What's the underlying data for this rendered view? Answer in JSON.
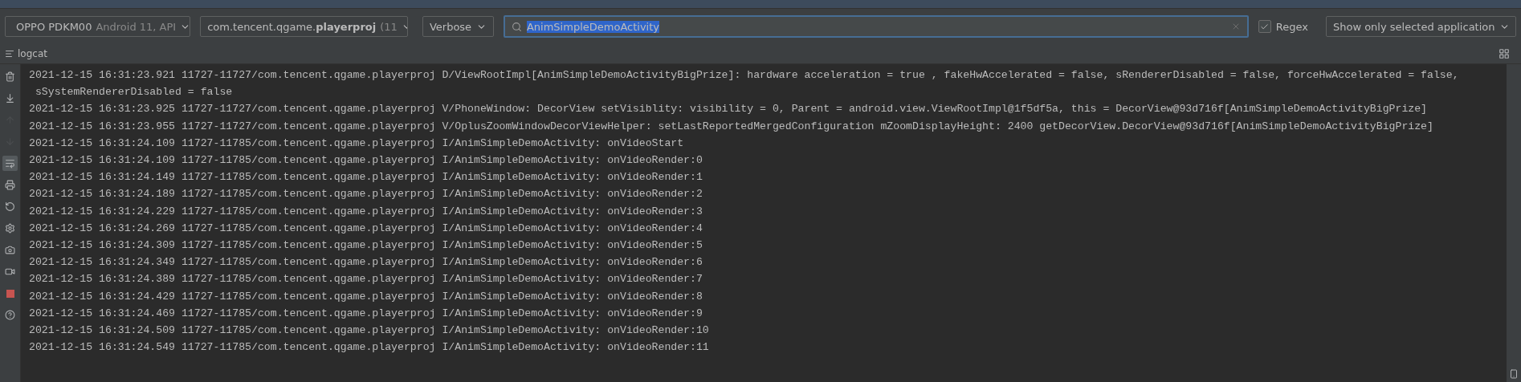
{
  "toolbar": {
    "device": {
      "name": "OPPO PDKM00",
      "detail": "Android 11, API"
    },
    "process": {
      "name": "com.tencent.qgame.**playerproj**",
      "detail": "(11"
    },
    "level": "Verbose",
    "search": {
      "value": "AnimSimpleDemoActivity",
      "selected": true
    },
    "regex": {
      "label": "Regex",
      "checked": true
    },
    "filter": "Show only selected application"
  },
  "tab": {
    "label": "logcat"
  },
  "side_tools": [
    {
      "kind": "trash",
      "disabled": false,
      "selected": false
    },
    {
      "kind": "scroll-end",
      "disabled": false,
      "selected": false
    },
    {
      "kind": "up",
      "disabled": true,
      "selected": false
    },
    {
      "kind": "down",
      "disabled": true,
      "selected": false
    },
    {
      "kind": "wrap",
      "disabled": false,
      "selected": true
    },
    {
      "kind": "print",
      "disabled": false,
      "selected": false
    },
    {
      "kind": "restart",
      "disabled": false,
      "selected": false
    },
    {
      "kind": "settings",
      "disabled": false,
      "selected": false
    },
    {
      "kind": "camera",
      "disabled": false,
      "selected": false
    },
    {
      "kind": "video",
      "disabled": false,
      "selected": false
    },
    {
      "kind": "stop",
      "disabled": false,
      "selected": false
    },
    {
      "kind": "help",
      "disabled": false,
      "selected": false
    }
  ],
  "log": [
    "2021-12-15 16:31:23.921 11727-11727/com.tencent.qgame.playerproj D/ViewRootImpl[AnimSimpleDemoActivityBigPrize]: hardware acceleration = true , fakeHwAccelerated = false, sRendererDisabled = false, forceHwAccelerated = false,\n sSystemRendererDisabled = false",
    "2021-12-15 16:31:23.925 11727-11727/com.tencent.qgame.playerproj V/PhoneWindow: DecorView setVisiblity: visibility = 0, Parent = android.view.ViewRootImpl@1f5df5a, this = DecorView@93d716f[AnimSimpleDemoActivityBigPrize]",
    "2021-12-15 16:31:23.955 11727-11727/com.tencent.qgame.playerproj V/OplusZoomWindowDecorViewHelper: setLastReportedMergedConfiguration mZoomDisplayHeight: 2400 getDecorView.DecorView@93d716f[AnimSimpleDemoActivityBigPrize]",
    "2021-12-15 16:31:24.109 11727-11785/com.tencent.qgame.playerproj I/AnimSimpleDemoActivity: onVideoStart",
    "2021-12-15 16:31:24.109 11727-11785/com.tencent.qgame.playerproj I/AnimSimpleDemoActivity: onVideoRender:0",
    "2021-12-15 16:31:24.149 11727-11785/com.tencent.qgame.playerproj I/AnimSimpleDemoActivity: onVideoRender:1",
    "2021-12-15 16:31:24.189 11727-11785/com.tencent.qgame.playerproj I/AnimSimpleDemoActivity: onVideoRender:2",
    "2021-12-15 16:31:24.229 11727-11785/com.tencent.qgame.playerproj I/AnimSimpleDemoActivity: onVideoRender:3",
    "2021-12-15 16:31:24.269 11727-11785/com.tencent.qgame.playerproj I/AnimSimpleDemoActivity: onVideoRender:4",
    "2021-12-15 16:31:24.309 11727-11785/com.tencent.qgame.playerproj I/AnimSimpleDemoActivity: onVideoRender:5",
    "2021-12-15 16:31:24.349 11727-11785/com.tencent.qgame.playerproj I/AnimSimpleDemoActivity: onVideoRender:6",
    "2021-12-15 16:31:24.389 11727-11785/com.tencent.qgame.playerproj I/AnimSimpleDemoActivity: onVideoRender:7",
    "2021-12-15 16:31:24.429 11727-11785/com.tencent.qgame.playerproj I/AnimSimpleDemoActivity: onVideoRender:8",
    "2021-12-15 16:31:24.469 11727-11785/com.tencent.qgame.playerproj I/AnimSimpleDemoActivity: onVideoRender:9",
    "2021-12-15 16:31:24.509 11727-11785/com.tencent.qgame.playerproj I/AnimSimpleDemoActivity: onVideoRender:10",
    "2021-12-15 16:31:24.549 11727-11785/com.tencent.qgame.playerproj I/AnimSimpleDemoActivity: onVideoRender:11"
  ]
}
